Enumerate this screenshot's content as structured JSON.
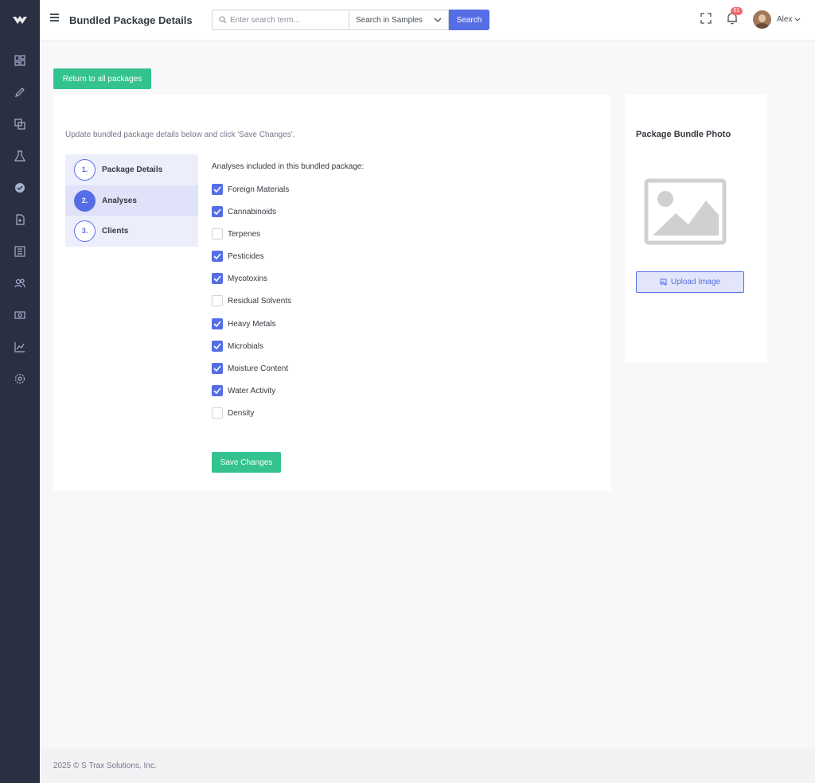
{
  "header": {
    "title": "Bundled Package Details",
    "search_placeholder": "Enter search term...",
    "search_scope": "Search in Samples",
    "search_button": "Search",
    "notification_count": "61",
    "user_name": "Alex"
  },
  "sidebar": {
    "items": [
      {
        "icon": "dashboard-icon"
      },
      {
        "icon": "edit-icon"
      },
      {
        "icon": "copy-icon"
      },
      {
        "icon": "flask-icon"
      },
      {
        "icon": "verified-badge-icon"
      },
      {
        "icon": "document-icon"
      },
      {
        "icon": "list-icon"
      },
      {
        "icon": "users-icon"
      },
      {
        "icon": "money-icon"
      },
      {
        "icon": "chart-icon"
      },
      {
        "icon": "settings-icon"
      }
    ]
  },
  "main": {
    "return_button": "Return to all packages",
    "intro": "Update bundled package details below and click 'Save Changes'.",
    "steps": [
      {
        "num": "1.",
        "label": "Package Details",
        "active": false
      },
      {
        "num": "2.",
        "label": "Analyses",
        "active": true
      },
      {
        "num": "3.",
        "label": "Clients",
        "active": false
      }
    ],
    "analyses_title": "Analyses included in this bundled package:",
    "analyses": [
      {
        "label": "Foreign Materials",
        "checked": true
      },
      {
        "label": "Cannabinoids",
        "checked": true
      },
      {
        "label": "Terpenes",
        "checked": false
      },
      {
        "label": "Pesticides",
        "checked": true
      },
      {
        "label": "Mycotoxins",
        "checked": true
      },
      {
        "label": "Residual Solvents",
        "checked": false
      },
      {
        "label": "Heavy Metals",
        "checked": true
      },
      {
        "label": "Microbials",
        "checked": true
      },
      {
        "label": "Moisture Content",
        "checked": true
      },
      {
        "label": "Water Activity",
        "checked": true
      },
      {
        "label": "Density",
        "checked": false
      }
    ],
    "save_button": "Save Changes"
  },
  "photo": {
    "title": "Package Bundle Photo",
    "upload_button": "Upload Image"
  },
  "footer": {
    "text": "2025 © S Trax Solutions, Inc."
  },
  "colors": {
    "primary": "#556ee6",
    "success": "#34c38f",
    "sidebar": "#2a3042",
    "danger": "#f46a6a"
  }
}
